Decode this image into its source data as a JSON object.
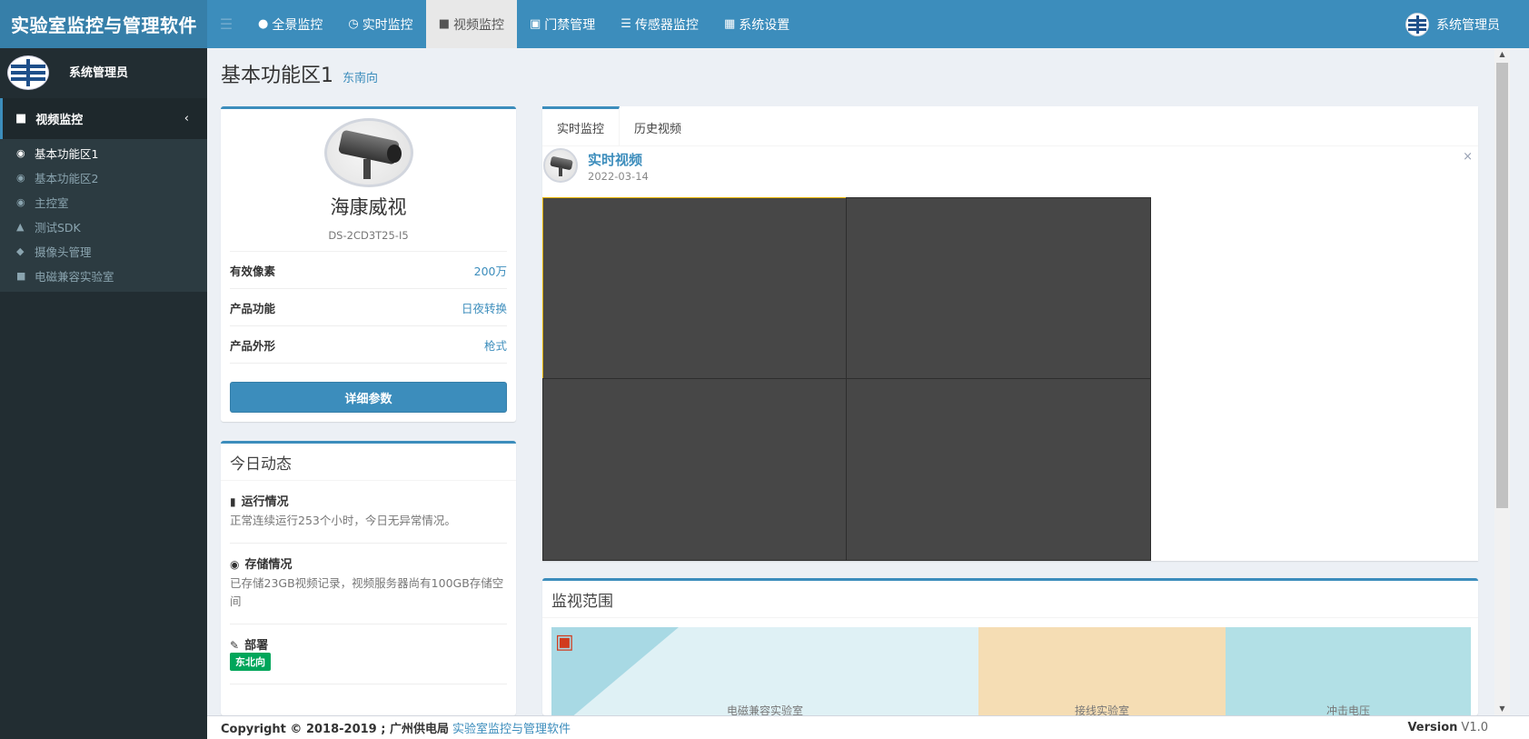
{
  "header": {
    "brand": "实验室监控与管理软件",
    "menu_toggle_icon": "menu-icon",
    "nav": [
      {
        "label": "全景监控",
        "icon": "user-icon"
      },
      {
        "label": "实时监控",
        "icon": "clock-icon"
      },
      {
        "label": "视频监控",
        "icon": "video-camera-icon",
        "active": true
      },
      {
        "label": "门禁管理",
        "icon": "lock-icon"
      },
      {
        "label": "传感器监控",
        "icon": "list-icon"
      },
      {
        "label": "系统设置",
        "icon": "window-icon"
      }
    ],
    "user_name": "系统管理员"
  },
  "sidebar": {
    "user_name": "系统管理员",
    "section_label": "视频监控",
    "items": [
      {
        "label": "基本功能区1",
        "active": true
      },
      {
        "label": "基本功能区2"
      },
      {
        "label": "主控室"
      },
      {
        "label": "测试SDK"
      },
      {
        "label": "摄像头管理"
      },
      {
        "label": "电磁兼容实验室"
      }
    ]
  },
  "page": {
    "title": "基本功能区1",
    "subtitle": "东南向"
  },
  "camera_profile": {
    "brand": "海康威视",
    "model": "DS-2CD3T25-I5",
    "properties": [
      {
        "key": "有效像素",
        "value": "200万"
      },
      {
        "key": "产品功能",
        "value": "日夜转换"
      },
      {
        "key": "产品外形",
        "value": "枪式"
      }
    ],
    "details_button": "详细参数"
  },
  "today": {
    "title": "今日动态",
    "items": [
      {
        "title": "运行情况",
        "icon": "book-icon",
        "desc": "正常连续运行253个小时，今日无异常情况。"
      },
      {
        "title": "存储情况",
        "icon": "map-marker-icon",
        "desc": "已存储23GB视频记录，视频服务器尚有100GB存储空间"
      },
      {
        "title": "部署",
        "icon": "pencil-icon",
        "badge": "东北向"
      }
    ]
  },
  "video_panel": {
    "tabs": [
      "实时监控",
      "历史视频"
    ],
    "active_tab": 0,
    "post_title": "实时视频",
    "post_date": "2022-03-14",
    "close_glyph": "×",
    "selected_cell": 0,
    "grid": {
      "rows": 2,
      "cols": 2
    }
  },
  "range": {
    "title": "监视范围",
    "zones": [
      {
        "label": "电磁兼容实验室",
        "color": "#dff1f5"
      },
      {
        "label": "接线实验室",
        "color": "#f5ddb4"
      },
      {
        "label": "冲击电压",
        "color": "#b2e0e6"
      }
    ]
  },
  "footer": {
    "copyright": "Copyright © 2018-2019 ; 广州供电局",
    "link": "实验室监控与管理软件",
    "version_label": "Version",
    "version": "V1.0"
  },
  "colors": {
    "primary": "#3c8dbc",
    "sidebar_bg": "#222d32",
    "success": "#00a65a",
    "video_bg": "#474747",
    "selected_border": "#e5b100"
  }
}
